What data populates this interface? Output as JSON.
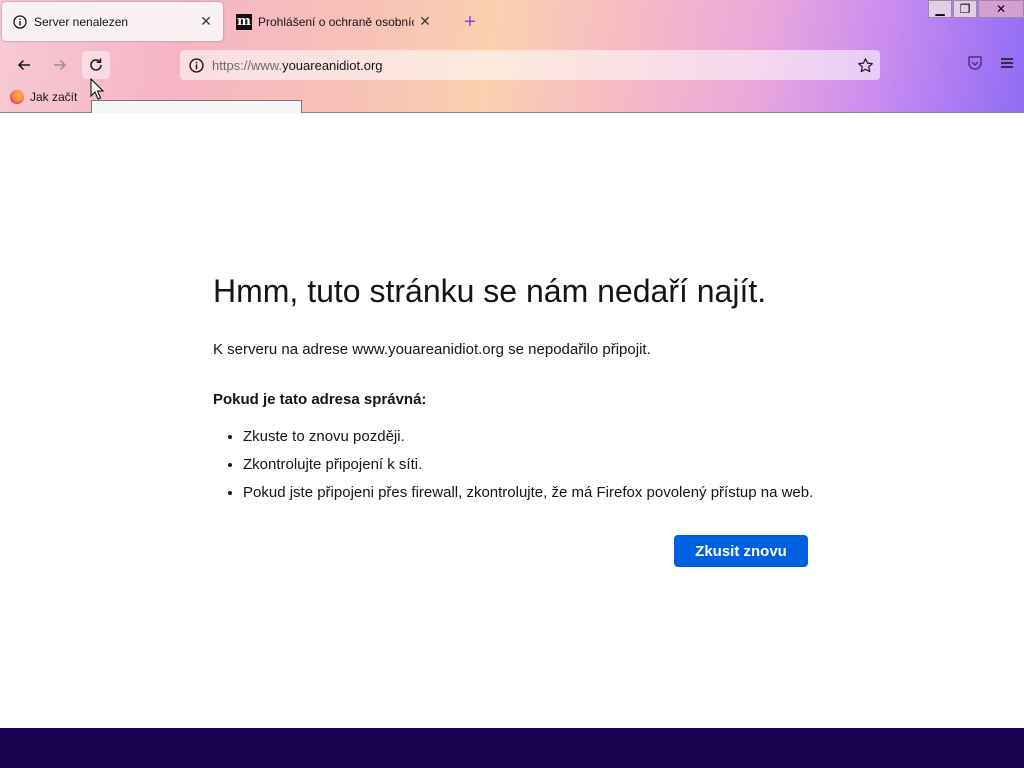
{
  "tabs": [
    {
      "title": "Server nenalezen",
      "close": "✕",
      "icon": "info-icon",
      "active": true
    },
    {
      "title": "Prohlášení o ochraně osobních",
      "close": "✕",
      "icon": "m-logo-icon",
      "icon_letter": "m",
      "active": false
    }
  ],
  "new_tab": "+",
  "window_controls": {
    "minimize": "▁",
    "maximize": "❐",
    "close": "✕"
  },
  "nav": {
    "back_icon": "arrow-left-icon",
    "forward_icon": "arrow-right-icon",
    "reload_icon": "reload-icon"
  },
  "urlbar": {
    "scheme": "https://www.",
    "domain": "youareanidiot.org"
  },
  "bookmarks": [
    {
      "label": "Jak začít",
      "icon": "firefox-icon"
    }
  ],
  "error": {
    "title": "Hmm, tuto stránku se nám nedaří najít.",
    "description": "K serveru na adrese www.youareanidiot.org se nepodařilo připojit.",
    "subtitle": "Pokud je tato adresa správná:",
    "items": [
      "Zkuste to znovu později.",
      "Zkontrolujte připojení k síti.",
      "Pokud jste připojeni přes firewall, zkontrolujte, že má Firefox povolený přístup na web."
    ],
    "retry_button": "Zkusit znovu"
  },
  "colors": {
    "accent": "#0061e0",
    "taskbar": "#1a0350",
    "new_tab": "#8b3fd1"
  }
}
